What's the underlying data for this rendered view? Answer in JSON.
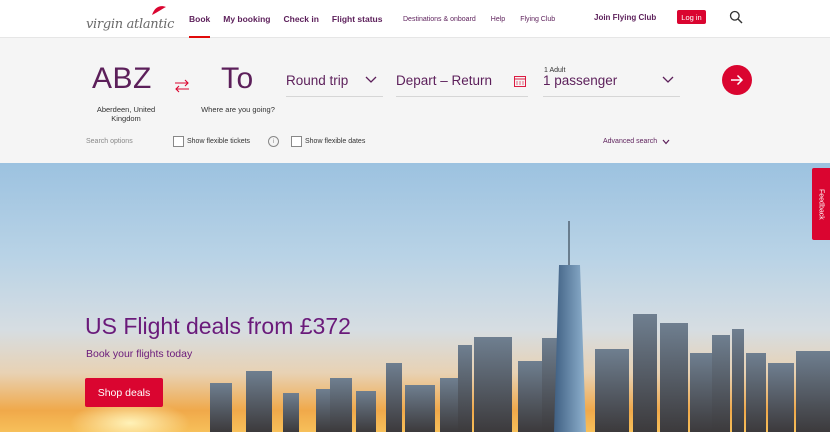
{
  "header": {
    "logo_text": "virgin atlantic",
    "primary_nav": [
      {
        "label": "Book",
        "active": true
      },
      {
        "label": "My booking"
      },
      {
        "label": "Check in"
      },
      {
        "label": "Flight status"
      }
    ],
    "secondary_nav": [
      {
        "label": "Destinations & onboard"
      },
      {
        "label": "Help"
      },
      {
        "label": "Flying Club"
      }
    ],
    "join_label": "Join Flying Club",
    "login_label": "Log in"
  },
  "search": {
    "from_code": "ABZ",
    "from_city": "Aberdeen, United Kingdom",
    "to_code": "To",
    "to_prompt": "Where are you going?",
    "trip_type": "Round trip",
    "dates": "Depart – Return",
    "passengers_small": "1 Adult",
    "passengers": "1 passenger",
    "options_label": "Search options",
    "flexible_tickets_label": "Show flexible tickets",
    "flexible_dates_label": "Show flexible dates",
    "advanced_label": "Advanced search"
  },
  "hero": {
    "title": "US Flight deals from £372",
    "subtitle": "Book your flights today",
    "cta_label": "Shop deals"
  },
  "feedback_label": "Feedback",
  "colors": {
    "brand_purple": "#5c1f5a",
    "brand_red": "#da0530"
  }
}
